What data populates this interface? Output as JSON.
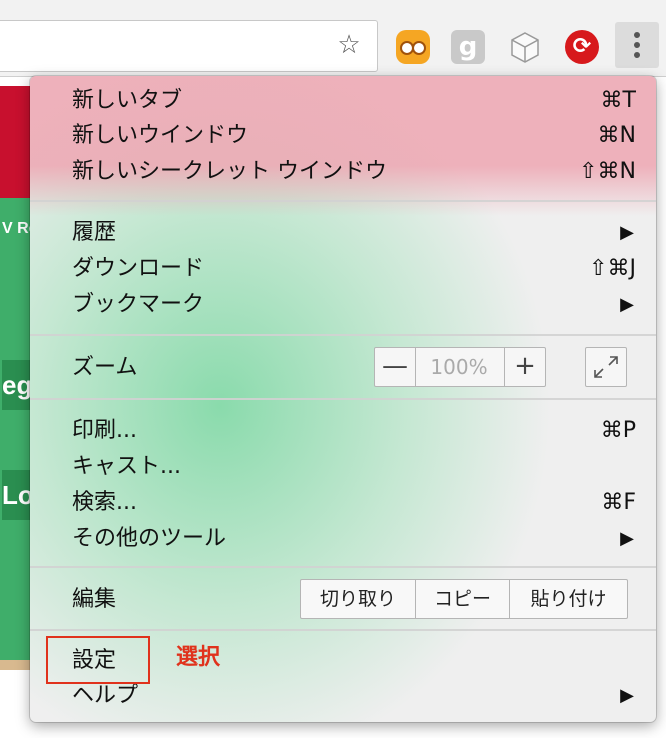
{
  "toolbar": {
    "bookmark_icon": "star-icon",
    "extensions": [
      "owl-extension-icon",
      "google-extension-icon",
      "cube-extension-icon",
      "trend-micro-extension-icon"
    ],
    "menu_icon": "kebab-menu-icon"
  },
  "page_behind": {
    "fragments": [
      "V Re",
      "eg",
      "Lo"
    ]
  },
  "menu": {
    "section1": [
      {
        "label": "新しいタブ",
        "shortcut": "⌘T"
      },
      {
        "label": "新しいウインドウ",
        "shortcut": "⌘N"
      },
      {
        "label": "新しいシークレット ウインドウ",
        "shortcut": "⇧⌘N"
      }
    ],
    "section2": [
      {
        "label": "履歴",
        "shortcut": "▶"
      },
      {
        "label": "ダウンロード",
        "shortcut": "⇧⌘J"
      },
      {
        "label": "ブックマーク",
        "shortcut": "▶"
      }
    ],
    "zoom": {
      "label": "ズーム",
      "minus": "—",
      "value": "100%",
      "plus": "+"
    },
    "section4": [
      {
        "label": "印刷...",
        "shortcut": "⌘P"
      },
      {
        "label": "キャスト...",
        "shortcut": ""
      },
      {
        "label": "検索...",
        "shortcut": "⌘F"
      },
      {
        "label": "その他のツール",
        "shortcut": "▶"
      }
    ],
    "edit": {
      "label": "編集",
      "cut": "切り取り",
      "copy": "コピー",
      "paste": "貼り付け"
    },
    "section6": [
      {
        "label": "設定",
        "shortcut": ""
      },
      {
        "label": "ヘルプ",
        "shortcut": "▶"
      }
    ]
  },
  "annotation": {
    "text": "選択",
    "color": "#e0321c"
  }
}
